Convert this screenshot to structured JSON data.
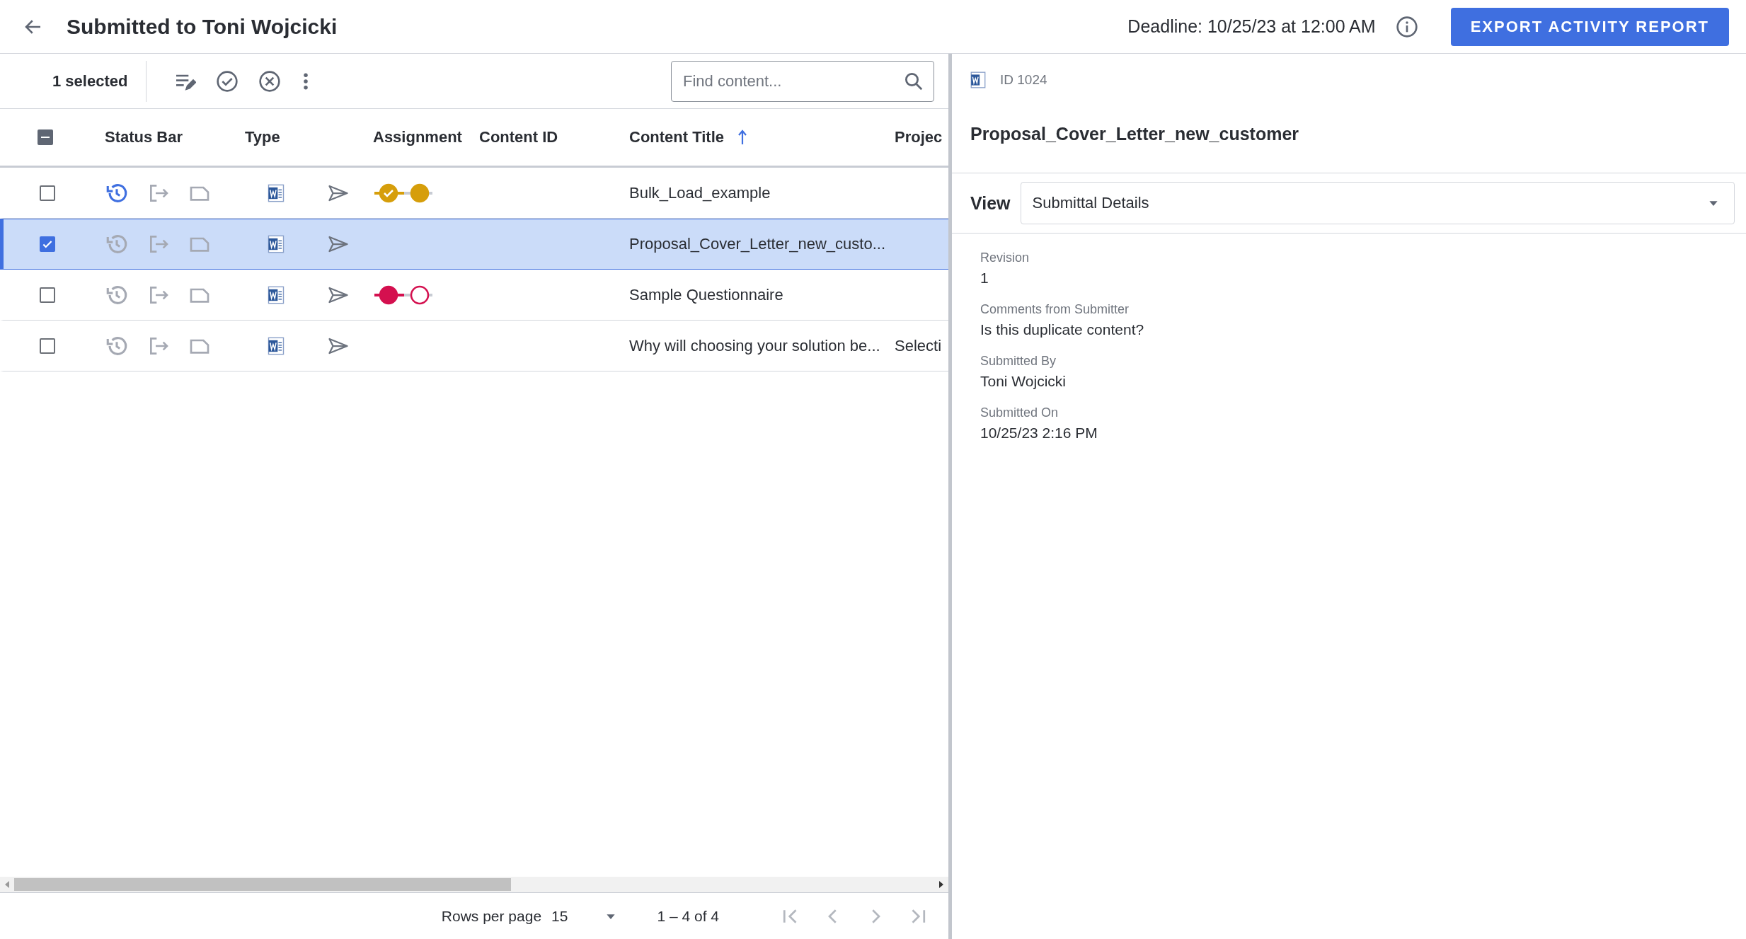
{
  "header": {
    "title": "Submitted to Toni Wojcicki",
    "deadline": "Deadline: 10/25/23 at 12:00 AM",
    "export_button": "EXPORT ACTIVITY REPORT"
  },
  "toolbar": {
    "selection_count": "1 selected",
    "search": {
      "placeholder": "Find content..."
    }
  },
  "table": {
    "select_all": {
      "indeterminate": true
    },
    "columns": [
      {
        "label": "Status Bar"
      },
      {
        "label": "Type"
      },
      {
        "label": "Assignment"
      },
      {
        "label": "Content ID"
      },
      {
        "label": "Content Title",
        "sorted": true
      },
      {
        "label": "Projec"
      }
    ],
    "rows": [
      {
        "selected": false,
        "checked": false,
        "history_active": true,
        "assignment": {
          "color": "#d69e0b",
          "steps": [
            {
              "filled": true,
              "checked": true
            },
            {
              "filled": true,
              "checked": false
            }
          ]
        },
        "title": "Bulk_Load_example"
      },
      {
        "selected": true,
        "checked": true,
        "history_active": false,
        "title": "Proposal_Cover_Letter_new_custo..."
      },
      {
        "selected": false,
        "checked": false,
        "history_active": false,
        "assignment": {
          "color": "#d4104f",
          "steps": [
            {
              "filled": true,
              "checked": false
            },
            {
              "filled": false,
              "checked": false
            }
          ]
        },
        "title": "Sample Questionnaire"
      },
      {
        "selected": false,
        "checked": false,
        "history_active": false,
        "title": "Why will choosing your solution be...",
        "project": "Selecti"
      }
    ]
  },
  "pagination": {
    "rows_per_page_label": "Rows per page",
    "rows_per_page": "15",
    "range": "1 – 4 of 4"
  },
  "detail": {
    "id": "ID 1024",
    "title": "Proposal_Cover_Letter_new_customer",
    "view_label": "View",
    "view_value": "Submittal Details",
    "fields": [
      {
        "label": "Revision",
        "value": "1"
      },
      {
        "label": "Comments from Submitter",
        "value": "Is this duplicate content?"
      },
      {
        "label": "Submitted By",
        "value": "Toni Wojcicki"
      },
      {
        "label": "Submitted On",
        "value": "10/25/23 2:16 PM"
      }
    ]
  }
}
